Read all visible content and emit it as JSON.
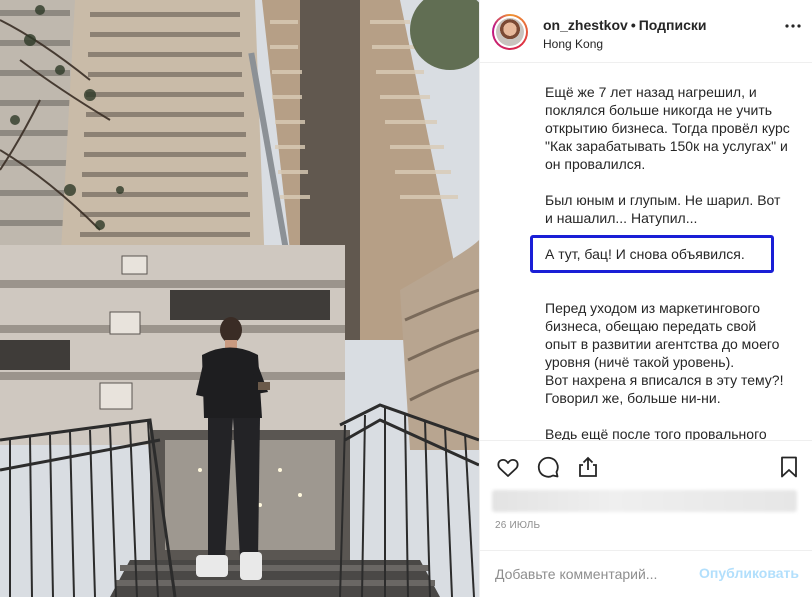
{
  "post": {
    "username": "on_zhestkov",
    "separator": "•",
    "follow_label": "Подписки",
    "location": "Hong Kong"
  },
  "caption": {
    "paragraphs": [
      "Ещё же 7 лет назад нагрешил, и поклялся больше никогда не учить открытию бизнеса. Тогда провёл курс \"Как зарабатывать 150к на услугах\" и он провалился.",
      "Был юным и глупым. Не шарил. Вот и нашалил... Натупил...",
      "А тут, бац! И снова объявился.",
      "Перед уходом из маркетингового бизнеса, обещаю передать свой опыт в развитии агентства до моего уровня (ничё такой уровень).",
      "Вот нахрена я вписался в эту тему?! Говорил же, больше ни-ни.",
      "Ведь ещё после того провального"
    ]
  },
  "icons": {
    "like": "heart-icon",
    "comment": "comment-icon",
    "share": "share-icon",
    "save": "bookmark-icon",
    "more": "more-icon"
  },
  "date": "26 ИЮЛЬ",
  "comment_box": {
    "placeholder": "Добавьте комментарий...",
    "publish_label": "Опубликовать"
  },
  "colors": {
    "highlight_border": "#1a1fd6",
    "publish_disabled": "#b2dffc",
    "text": "#262626",
    "muted": "#8e8e8e"
  }
}
